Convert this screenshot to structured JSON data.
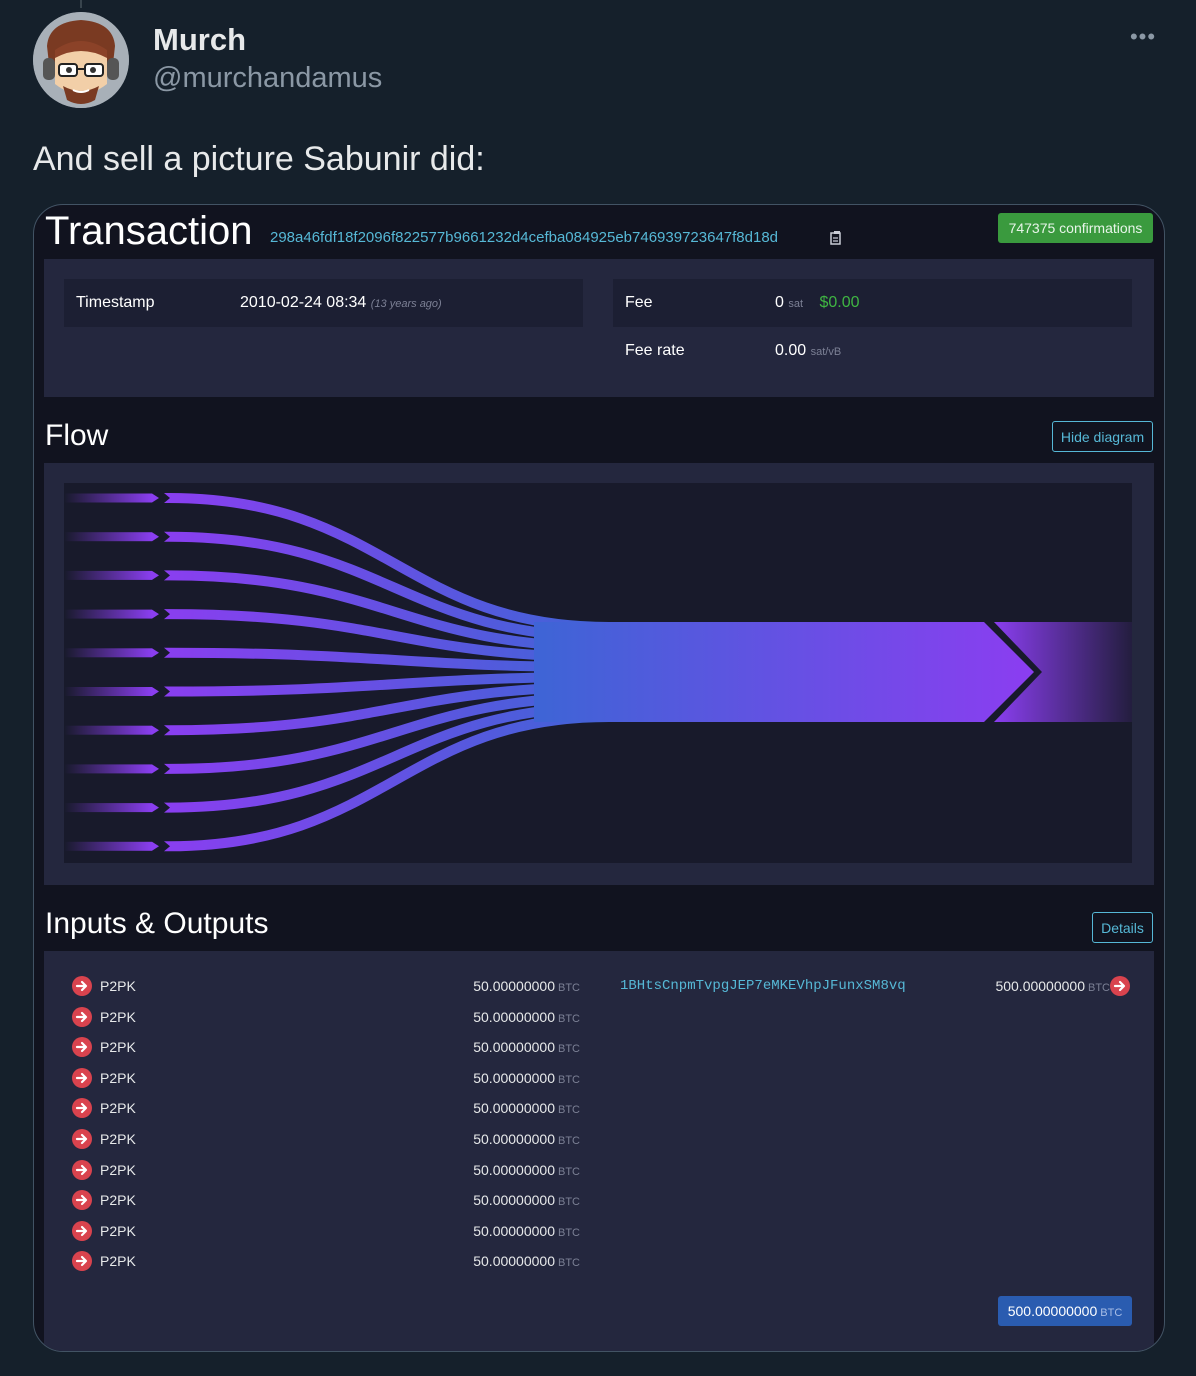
{
  "tweet": {
    "name": "Murch",
    "handle": "@murchandamus",
    "more_label": "•••",
    "text": "And sell a picture Sabunir did:"
  },
  "tx": {
    "title": "Transaction",
    "hash": "298a46fdf18f2096f822577b9661232d4cefba084925eb746939723647f8d18d",
    "confirmations": "747375 confirmations",
    "timestamp_label": "Timestamp",
    "timestamp_value": "2010-02-24 08:34",
    "timestamp_ago": "(13 years ago)",
    "fee_label": "Fee",
    "fee_value": "0",
    "fee_unit": "sat",
    "fee_usd": "$0.00",
    "feerate_label": "Fee rate",
    "feerate_value": "0.00",
    "feerate_unit": "sat/vB"
  },
  "flow": {
    "title": "Flow",
    "hide_label": "Hide diagram",
    "input_count": 10,
    "output_count": 1
  },
  "io": {
    "title": "Inputs & Outputs",
    "details_label": "Details",
    "btc_unit": "BTC",
    "inputs": [
      {
        "type": "P2PK",
        "amount": "50.00000000"
      },
      {
        "type": "P2PK",
        "amount": "50.00000000"
      },
      {
        "type": "P2PK",
        "amount": "50.00000000"
      },
      {
        "type": "P2PK",
        "amount": "50.00000000"
      },
      {
        "type": "P2PK",
        "amount": "50.00000000"
      },
      {
        "type": "P2PK",
        "amount": "50.00000000"
      },
      {
        "type": "P2PK",
        "amount": "50.00000000"
      },
      {
        "type": "P2PK",
        "amount": "50.00000000"
      },
      {
        "type": "P2PK",
        "amount": "50.00000000"
      },
      {
        "type": "P2PK",
        "amount": "50.00000000"
      }
    ],
    "output": {
      "address": "1BHtsCnpmTvpgJEP7eMKEVhpJFunxSM8vq",
      "amount": "500.00000000"
    },
    "total": "500.00000000"
  },
  "colors": {
    "accent": "#56b8d6",
    "confirm_green": "#3a9a3e",
    "usd_green": "#3fb542",
    "flow_purple": "#8a3ef0",
    "flow_blue": "#3f64d6",
    "red_arrow": "#d9434e",
    "total_blue": "#2a5cb0"
  }
}
